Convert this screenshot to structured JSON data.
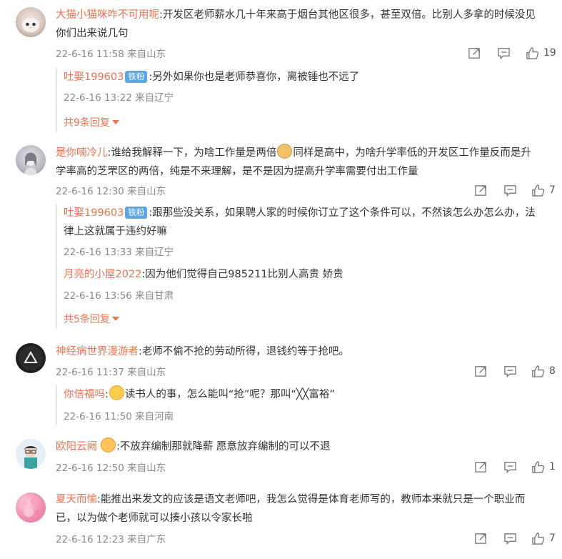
{
  "comments": [
    {
      "name": "大猫小猫咪咋不可用呢",
      "text_line1": ":开发区老师薪水几十年来高于烟台其他区很多，甚至双倍。比别人多拿的时候没见",
      "text_line2": "你们出来说几句",
      "time": "22-6-16 11:58 来自山东",
      "likes": "19",
      "replies": [
        {
          "name": "吐娶199603",
          "badge": "铁粉",
          "text": ":另外如果你也是老师恭喜你，离被锤也不远了",
          "time": "22-6-16 13:22 来自辽宁"
        }
      ],
      "more": "共9条回复"
    },
    {
      "name": "是你喃冷儿",
      "text_line1_a": ":谁给我解释一下，为啥工作量是两倍",
      "text_line1_b": "同样是高中，为啥升学率低的开发区工作量反而是升",
      "text_line2": "学率高的芝罘区的两倍，纯是不来理解，是不是因为提高升学率需要付出工作量",
      "time": "22-6-16 12:30 来自山东",
      "likes": "7",
      "replies": [
        {
          "name": "吐娶199603",
          "badge": "铁粉",
          "text_line1": ":跟那些没关系，如果聘人家的时候你订立了这个条件可以，不然该怎么办怎么办，法",
          "text_line2": "律上这就属于违约好嘛",
          "time": "22-6-16 13:33 来自辽宁"
        },
        {
          "name": "月亮的小屋2022",
          "text": ":因为他们觉得自己985211比别人高贵 娇贵",
          "time": "22-6-16 13:56 来自甘肃"
        }
      ],
      "more": "共5条回复"
    },
    {
      "name": "神经病世界漫游者",
      "text": ":老师不偷不抢的劳动所得，退钱约等于抢吧。",
      "time": "22-6-16 11:37 来自山东",
      "likes": "8",
      "replies": [
        {
          "name": "你信福吗",
          "text_a": ":",
          "text_b": "读书人的事，怎么能叫“抢”呢？那叫“╳╳富裕”",
          "time": "22-6-16 11:50 来自河南"
        }
      ]
    },
    {
      "name": "欧阳云阙",
      "text": ":不放弃编制那就降薪 愿意放弃编制的可以不退",
      "time": "22-6-16 12:50 来自山东",
      "likes": "1"
    },
    {
      "name": "夏天而愉",
      "text_line1": ":能推出来发文的应该是语文老师吧，我怎么觉得是体育老师写的，教师本来就只是一个职业而",
      "text_line2": "已，以为做个老师就可以揍小孩以令家长啪",
      "time": "22-6-16 12:23 来自广东",
      "likes": "7"
    }
  ],
  "icons": {
    "share": "share-icon",
    "comment": "comment-icon",
    "like": "thumbs-up-icon"
  },
  "colors": {
    "name": "#eb7350",
    "badge": "#5aa6e8",
    "meta": "#8a8a8a"
  }
}
